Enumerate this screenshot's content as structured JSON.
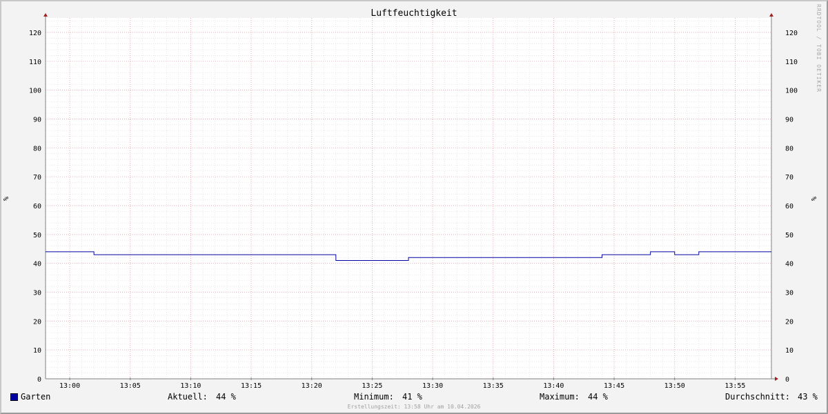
{
  "chart_data": {
    "type": "line",
    "title": "Luftfeuchtigkeit",
    "ylabel": "%",
    "ylabel_right": "%",
    "ylim": [
      0,
      125
    ],
    "yticks": [
      0,
      10,
      20,
      30,
      40,
      50,
      60,
      70,
      80,
      90,
      100,
      110,
      120
    ],
    "xlim": [
      "12:58",
      "13:58"
    ],
    "xticks": [
      "13:00",
      "13:05",
      "13:10",
      "13:15",
      "13:20",
      "13:25",
      "13:30",
      "13:35",
      "13:40",
      "13:45",
      "13:50",
      "13:55"
    ],
    "grid": true,
    "series": [
      {
        "name": "Garten",
        "color": "#0000a0",
        "step": true,
        "points": [
          [
            "12:58",
            44
          ],
          [
            "13:02",
            43
          ],
          [
            "13:22",
            41
          ],
          [
            "13:28",
            42
          ],
          [
            "13:44",
            43
          ],
          [
            "13:48",
            44
          ],
          [
            "13:50",
            43
          ],
          [
            "13:52",
            44
          ],
          [
            "13:58",
            44
          ]
        ]
      }
    ]
  },
  "legend": {
    "series_name": "Garten",
    "aktuell_label": "Aktuell:",
    "aktuell_value": "44 %",
    "minimum_label": "Minimum:",
    "minimum_value": "41 %",
    "maximum_label": "Maximum:",
    "maximum_value": "44 %",
    "durchschnitt_label": "Durchschnitt:",
    "durchschnitt_value": "43 %"
  },
  "footer": "Erstellungszeit: 13:58 Uhr am 10.04.2026",
  "watermark": "RRDTOOL / TOBI OETIKER"
}
